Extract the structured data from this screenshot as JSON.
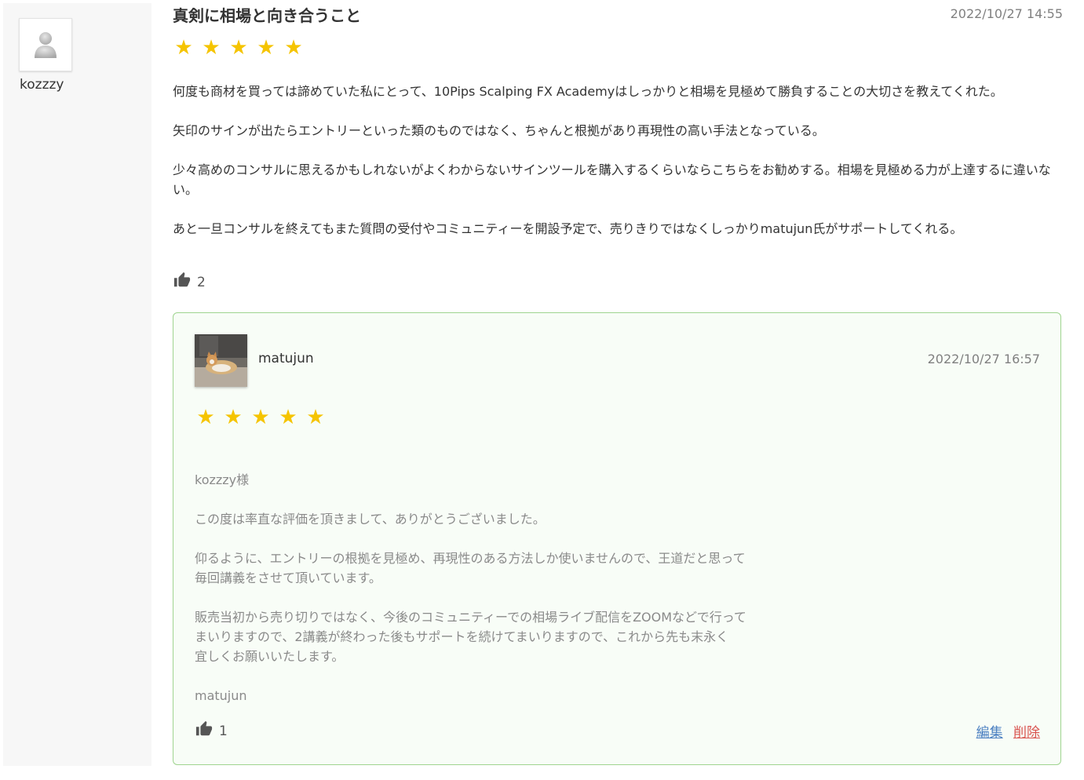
{
  "review": {
    "author": "kozzzy",
    "avatar_icon": "default-user-icon",
    "title": "真剣に相場と向き合うこと",
    "date": "2022/10/27 14:55",
    "rating": 5,
    "stars": [
      "★",
      "★",
      "★",
      "★",
      "★"
    ],
    "paragraphs": [
      "何度も商材を買っては諦めていた私にとって、10Pips Scalping FX Academyはしっかりと相場を見極めて勝負することの大切さを教えてくれた。",
      "矢印のサインが出たらエントリーといった類のものではなく、ちゃんと根拠があり再現性の高い手法となっている。",
      "少々高めのコンサルに思えるかもしれないがよくわからないサインツールを購入するくらいならこちらをお勧めする。相場を見極める力が上達するに違いない。",
      "あと一旦コンサルを終えてもまた質問の受付やコミュニティーを開設予定で、売りきりではなくしっかりmatujun氏がサポートしてくれる。"
    ],
    "like_icon": "thumbs-up-icon",
    "likes": "2"
  },
  "reply": {
    "author": "matujun",
    "avatar_icon": "cat-photo-avatar",
    "date": "2022/10/27 16:57",
    "rating": 5,
    "stars": [
      "★",
      "★",
      "★",
      "★",
      "★"
    ],
    "paragraphs": [
      "kozzzy様",
      "この度は率直な評価を頂きまして、ありがとうございました。",
      "仰るように、エントリーの根拠を見極め、再現性のある方法しか使いませんので、王道だと思って\n毎回講義をさせて頂いています。",
      "販売当初から売り切りではなく、今後のコミュニティーでの相場ライブ配信をZOOMなどで行って\nまいりますので、2講義が終わった後もサポートを続けてまいりますので、これから先も末永く\n宜しくお願いいたします。",
      "matujun"
    ],
    "likes": "1",
    "edit_label": "編集",
    "delete_label": "削除"
  },
  "colors": {
    "star": "#f5c400",
    "reply_border": "#9fd48f",
    "reply_bg": "#f8fdf7",
    "edit_link": "#4a7fc1",
    "delete_link": "#d9534f"
  }
}
